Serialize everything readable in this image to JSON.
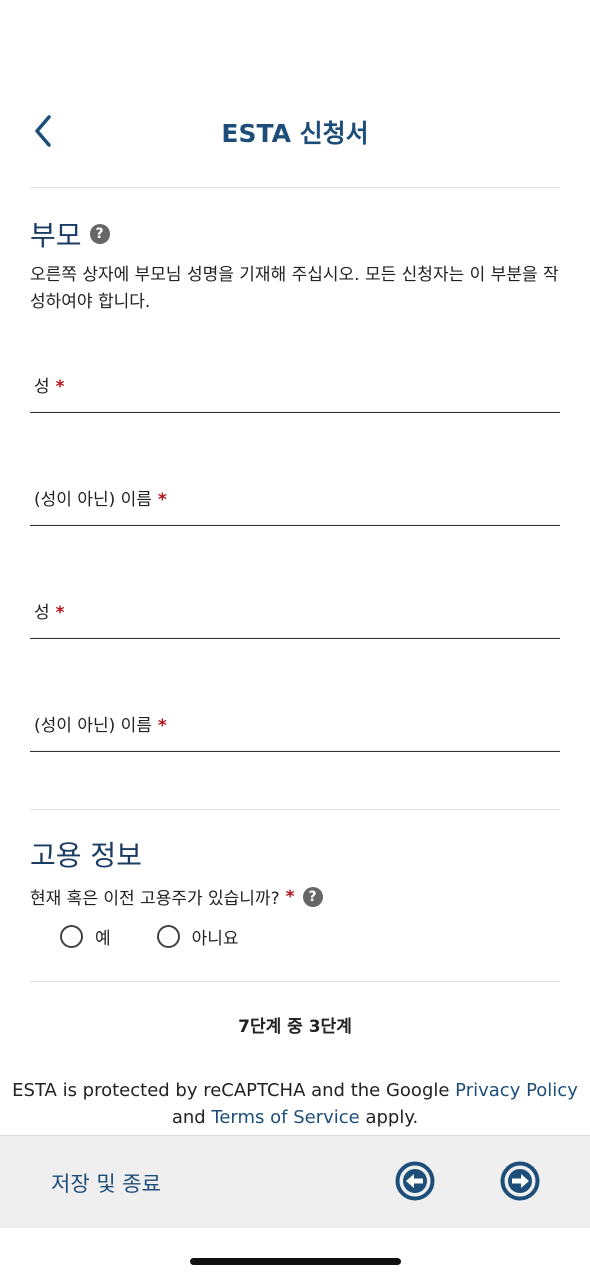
{
  "header": {
    "title": "ESTA 신청서",
    "back_icon": "chevron-left-icon"
  },
  "parents": {
    "title": "부모",
    "help_icon": "?",
    "description": "오른쪽 상자에 부모님 성명을 기재해 주십시오. 모든 신청자는 이 부분을 작성하여야 합니다.",
    "fields": [
      {
        "label": "성",
        "required": "*"
      },
      {
        "label": "(성이 아닌) 이름",
        "required": "*"
      },
      {
        "label": "성",
        "required": "*"
      },
      {
        "label": "(성이 아닌) 이름",
        "required": "*"
      }
    ]
  },
  "employment": {
    "title": "고용 정보",
    "question": "현재 혹은 이전 고용주가 있습니까?",
    "required": "*",
    "help_icon": "?",
    "options": [
      "예",
      "아니요"
    ]
  },
  "progress": {
    "text": "7단계 중 3단계"
  },
  "recaptcha": {
    "prefix": "ESTA is protected by reCAPTCHA and the Google ",
    "privacy_link": "Privacy Policy",
    "middle": "and ",
    "terms_link": "Terms of Service",
    "suffix": " apply."
  },
  "footer": {
    "save_exit": "저장 및 종료",
    "prev_icon": "arrow-left-circle-icon",
    "next_icon": "arrow-right-circle-icon"
  },
  "colors": {
    "brand": "#1d4e79",
    "required": "#b8121b",
    "footer_bg": "#efefef"
  }
}
